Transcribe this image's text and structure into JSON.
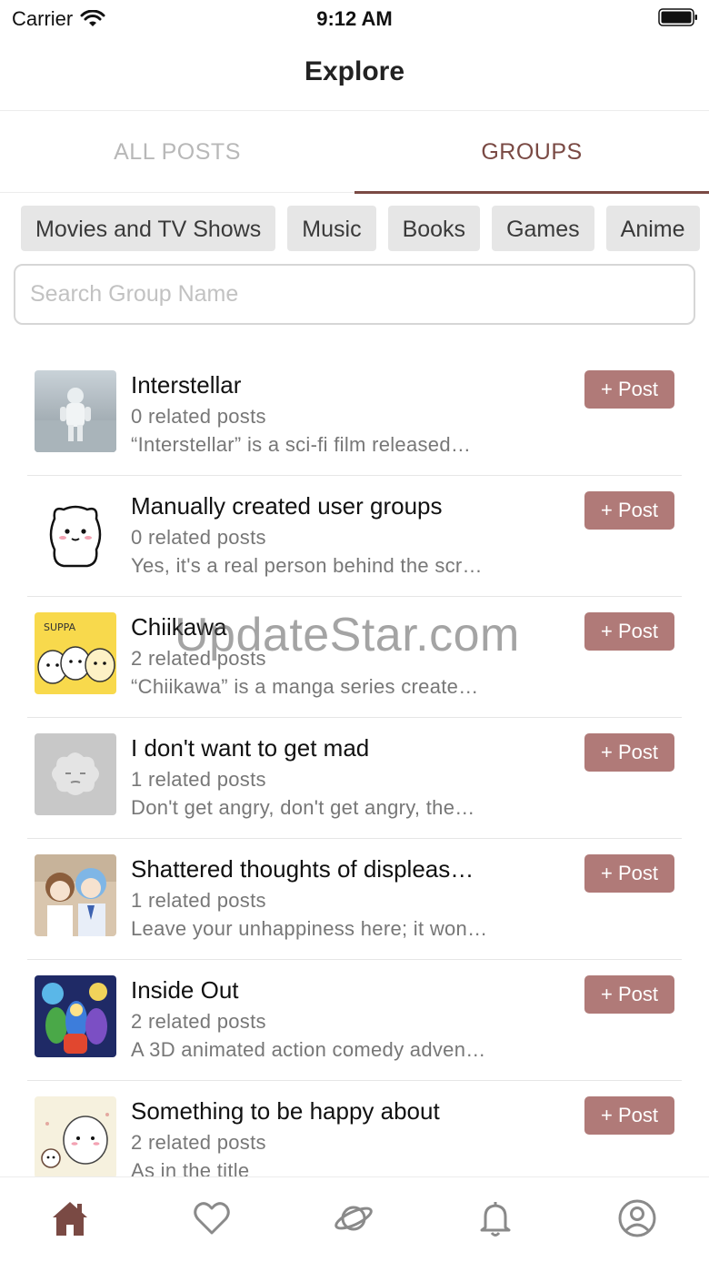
{
  "status": {
    "carrier": "Carrier",
    "time": "9:12 AM"
  },
  "header": {
    "title": "Explore"
  },
  "tabs": [
    {
      "label": "ALL POSTS",
      "active": false
    },
    {
      "label": "GROUPS",
      "active": true
    }
  ],
  "categories": [
    "Movies and TV Shows",
    "Music",
    "Books",
    "Games",
    "Anime"
  ],
  "search": {
    "placeholder": "Search Group Name",
    "value": ""
  },
  "groups": [
    {
      "title": "Interstellar",
      "count": "0 related posts",
      "desc": "“Interstellar” is a sci-fi film released…",
      "button": "+ Post",
      "thumb": "astronaut-image"
    },
    {
      "title": "Manually created user groups",
      "count": "0 related posts",
      "desc": "Yes, it's a real person behind the scr…",
      "button": "+ Post",
      "thumb": "white-bear-image"
    },
    {
      "title": "Chiikawa",
      "count": "2 related posts",
      "desc": "“Chiikawa” is a manga series create…",
      "button": "+ Post",
      "thumb": "chiikawa-image"
    },
    {
      "title": "I don't want to get mad",
      "count": "1 related posts",
      "desc": "Don't get angry, don't get angry, the…",
      "button": "+ Post",
      "thumb": "grey-cloud-image"
    },
    {
      "title": "Shattered thoughts of displeas…",
      "count": "1 related posts",
      "desc": "Leave your unhappiness here; it won…",
      "button": "+ Post",
      "thumb": "anime-girls-image"
    },
    {
      "title": "Inside Out",
      "count": "2 related posts",
      "desc": "A 3D animated action comedy adven…",
      "button": "+ Post",
      "thumb": "inside-out-image"
    },
    {
      "title": "Something to be happy about",
      "count": "2 related posts",
      "desc": "As in the title",
      "button": "+ Post",
      "thumb": "happy-bear-image"
    }
  ],
  "watermark": "UpdateStar.com",
  "tabbar": [
    "home-icon",
    "heart-icon",
    "planet-icon",
    "bell-icon",
    "profile-icon"
  ],
  "colors": {
    "accent": "#7a4a44",
    "button": "#b07a78",
    "chip": "#e6e6e6",
    "inactive": "#b8b8b8"
  }
}
